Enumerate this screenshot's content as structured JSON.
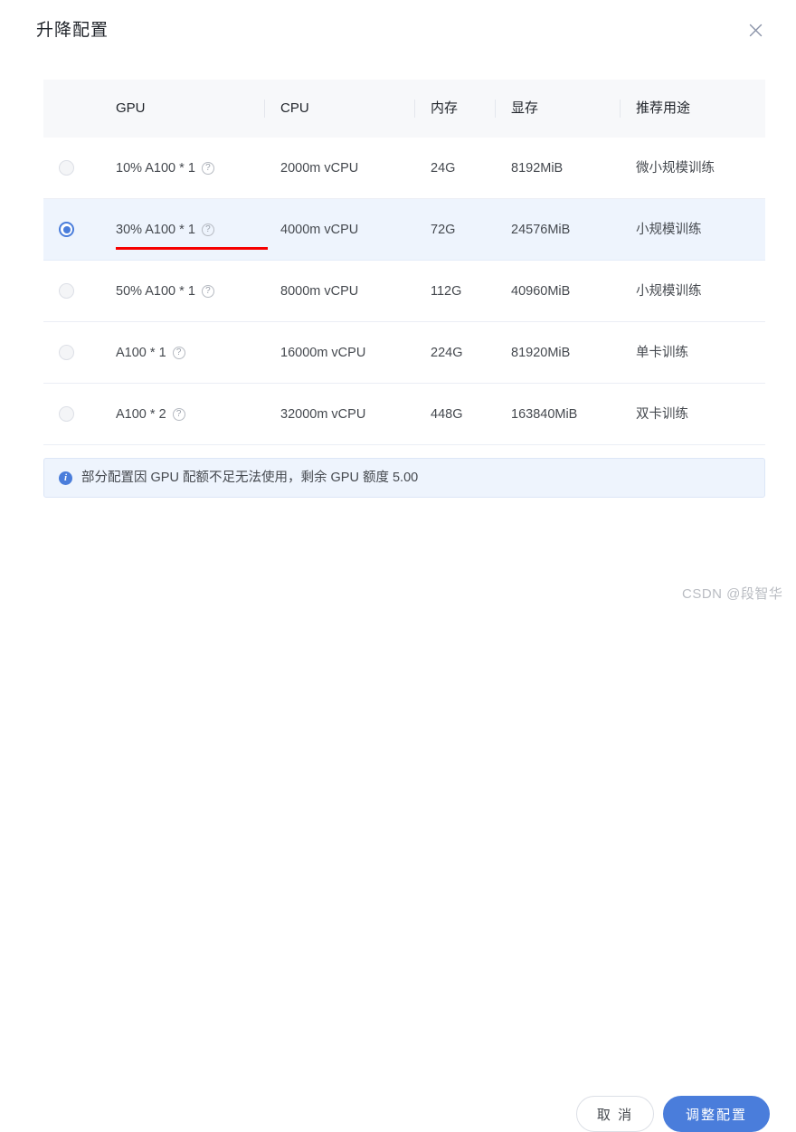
{
  "dialog": {
    "title": "升降配置",
    "close_icon": "close-icon"
  },
  "table": {
    "columns": [
      {
        "key": "radio",
        "label": ""
      },
      {
        "key": "gpu",
        "label": "GPU"
      },
      {
        "key": "cpu",
        "label": "CPU"
      },
      {
        "key": "memory",
        "label": "内存"
      },
      {
        "key": "vram",
        "label": "显存"
      },
      {
        "key": "usage",
        "label": "推荐用途"
      }
    ],
    "rows": [
      {
        "selected": false,
        "gpu": "10% A100 * 1",
        "cpu": "2000m vCPU",
        "memory": "24G",
        "vram": "8192MiB",
        "usage": "微小规模训练"
      },
      {
        "selected": true,
        "gpu": "30% A100 * 1",
        "cpu": "4000m vCPU",
        "memory": "72G",
        "vram": "24576MiB",
        "usage": "小规模训练"
      },
      {
        "selected": false,
        "gpu": "50% A100 * 1",
        "cpu": "8000m vCPU",
        "memory": "112G",
        "vram": "40960MiB",
        "usage": "小规模训练"
      },
      {
        "selected": false,
        "gpu": "A100 * 1",
        "cpu": "16000m vCPU",
        "memory": "224G",
        "vram": "81920MiB",
        "usage": "单卡训练"
      },
      {
        "selected": false,
        "gpu": "A100 * 2",
        "cpu": "32000m vCPU",
        "memory": "448G",
        "vram": "163840MiB",
        "usage": "双卡训练"
      }
    ],
    "help_icon_glyph": "?"
  },
  "info_banner": {
    "icon": "info-icon",
    "icon_glyph": "i",
    "text": "部分配置因 GPU 配额不足无法使用，剩余 GPU 额度 5.00"
  },
  "footer": {
    "cancel_label": "取 消",
    "primary_label": "调整配置"
  },
  "annotation": {
    "red_underline_target": "30% A100 * 1"
  },
  "watermark": {
    "text": "CSDN @段智华"
  },
  "colors": {
    "accent": "#4a7ddb",
    "selected_row_bg": "#eef4fd",
    "header_bg": "#f7f8fa",
    "annotation_red": "#f60000"
  }
}
